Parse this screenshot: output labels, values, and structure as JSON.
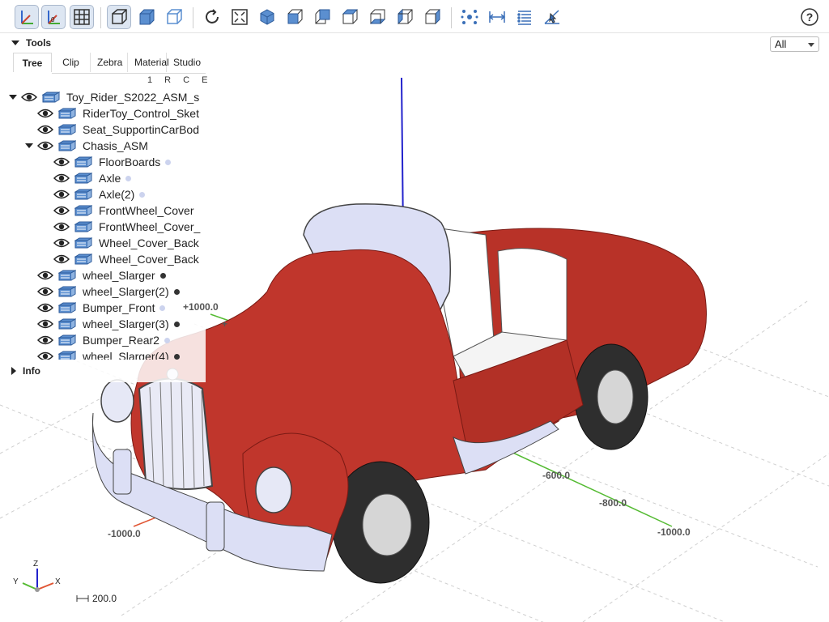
{
  "toolbar": {
    "buttons": [
      "axes",
      "axes-origin",
      "grid",
      "perspective",
      "ortho",
      "transparent",
      "reset-view",
      "fit-view",
      "iso-view",
      "front-view",
      "rear-view",
      "top-view",
      "bottom-view",
      "left-view",
      "right-view",
      "explode",
      "distance",
      "properties",
      "select",
      "help"
    ]
  },
  "tools": {
    "title": "Tools",
    "tabs": [
      "Tree",
      "Clip",
      "Zebra",
      "Material",
      "Studio"
    ],
    "active_tab": "Tree",
    "column_headers": "1 R C E"
  },
  "tree": [
    {
      "label": "Toy_Rider_S2022_ASM_s",
      "level": 0,
      "expanded": true,
      "dot": null
    },
    {
      "label": "RiderToy_Control_Sket",
      "level": 1,
      "expanded": null,
      "dot": null
    },
    {
      "label": "Seat_SupportinCarBod",
      "level": 1,
      "expanded": null,
      "dot": null
    },
    {
      "label": "Chasis_ASM",
      "level": 1,
      "expanded": true,
      "dot": null
    },
    {
      "label": "FloorBoards",
      "level": 2,
      "expanded": null,
      "dot": "#ccd3ee"
    },
    {
      "label": "Axle",
      "level": 2,
      "expanded": null,
      "dot": "#ccd3ee"
    },
    {
      "label": "Axle(2)",
      "level": 2,
      "expanded": null,
      "dot": "#ccd3ee"
    },
    {
      "label": "FrontWheel_Cover",
      "level": 2,
      "expanded": null,
      "dot": null
    },
    {
      "label": "FrontWheel_Cover_",
      "level": 2,
      "expanded": null,
      "dot": null
    },
    {
      "label": "Wheel_Cover_Back",
      "level": 2,
      "expanded": null,
      "dot": null
    },
    {
      "label": "Wheel_Cover_Back",
      "level": 2,
      "expanded": null,
      "dot": null
    },
    {
      "label": "wheel_Slarger",
      "level": 1,
      "expanded": null,
      "dot": "#333333"
    },
    {
      "label": "wheel_Slarger(2)",
      "level": 1,
      "expanded": null,
      "dot": "#333333"
    },
    {
      "label": "Bumper_Front",
      "level": 1,
      "expanded": null,
      "dot": "#ccd3ee"
    },
    {
      "label": "wheel_Slarger(3)",
      "level": 1,
      "expanded": null,
      "dot": "#333333"
    },
    {
      "label": "Bumper_Rear2",
      "level": 1,
      "expanded": null,
      "dot": "#ccd3ee"
    },
    {
      "label": "wheel_Slarger(4)",
      "level": 1,
      "expanded": null,
      "dot": "#333333"
    }
  ],
  "info": {
    "title": "Info"
  },
  "filter": {
    "value": "All"
  },
  "axis_labels": {
    "y_pos_1000": "+1000.0",
    "x_neg_1000": "-1000.0",
    "y_neg_600": "-600.0",
    "y_neg_800": "-800.0",
    "y_neg_1000": "-1000.0",
    "y_pos_partial": "+"
  },
  "triad": {
    "z": "Z",
    "y": "Y",
    "x": "X"
  },
  "scale": {
    "value": "200.0"
  },
  "colors": {
    "body": "#c0362c",
    "trim": "#dcdff5",
    "tire": "#2e2e2e",
    "axis_z": "#2222cc",
    "axis_y": "#55bb33",
    "axis_x": "#e05533",
    "accent": "#3a6fb8"
  }
}
